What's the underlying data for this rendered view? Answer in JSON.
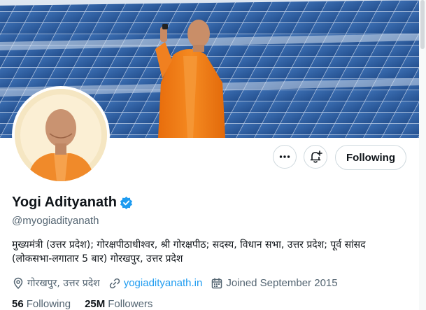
{
  "profile": {
    "display_name": "Yogi Adityanath",
    "handle": "@myogiadityanath",
    "bio_lines": [
      "मुख्यमंत्री (उत्तर प्रदेश); गोरक्षपीठाधीश्वर, श्री गोरक्षपीठ; सदस्य, विधान सभा, उत्तर प्रदेश; पूर्व सांसद",
      "(लोकसभा-लगातार 5 बार) गोरखपुर, उत्तर प्रदेश"
    ],
    "location": "गोरखपुर, उत्तर प्रदेश",
    "website": "yogiadityanath.in",
    "joined": "Joined September 2015",
    "following_count": "56",
    "following_label": "Following",
    "followers_count": "25M",
    "followers_label": "Followers",
    "verified_icon": "verified-badge-icon"
  },
  "actions": {
    "more_icon": "more-icon",
    "notify_icon": "notification-bell-icon",
    "following_button": "Following"
  },
  "colors": {
    "accent": "#1d9bf0",
    "text_primary": "#0f1419",
    "text_secondary": "#536471",
    "border": "#cfd9de",
    "saffron": "#ef7f1a"
  }
}
